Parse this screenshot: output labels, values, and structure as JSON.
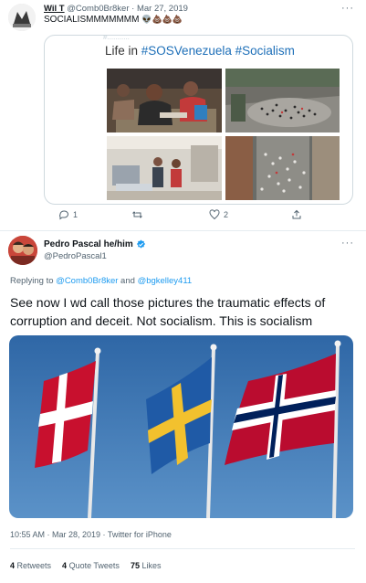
{
  "quoted_tweet": {
    "display_name": "Wil T",
    "handle": "@Comb0Br8ker",
    "separator": "·",
    "date": "Mar 27, 2019",
    "text": "SOCIALISMMMMMMM",
    "emoji": "👽💩💩💩",
    "card": {
      "top_strip_text": "#...........",
      "title_prefix": "Life in ",
      "hashtag_1": "#SOSVenezuela",
      "hashtag_2": "#Socialism"
    },
    "actions": {
      "reply_count": "1",
      "retweet_count": "",
      "like_count": "2"
    }
  },
  "tweet": {
    "display_name": "Pedro Pascal he/him",
    "verified": true,
    "handle": "@PedroPascal1",
    "replying_to_prefix": "Replying to ",
    "replying_to_1": "@Comb0Br8ker",
    "replying_to_and": " and ",
    "replying_to_2": "@bgkelley411",
    "text": "See now I wd call those pictures the traumatic effects of corruption and deceit. Not socialism. This is socialism",
    "timestamp": "10:55 AM · Mar 28, 2019 · Twitter for iPhone",
    "stats": {
      "retweets_count": "4",
      "retweets_label": " Retweets",
      "quote_count": "4",
      "quote_label": " Quote Tweets",
      "likes_count": "75",
      "likes_label": " Likes"
    }
  },
  "more_icon_glyph": "···",
  "colors": {
    "link": "#1d9bf0",
    "secondary_text": "#536471",
    "denmark_red": "#c8102e",
    "sweden_blue": "#1f5aa6",
    "sweden_yellow": "#f2c12e",
    "norway_red": "#ba0c2f",
    "norway_blue": "#00205b",
    "sky": "#3f78b5"
  }
}
